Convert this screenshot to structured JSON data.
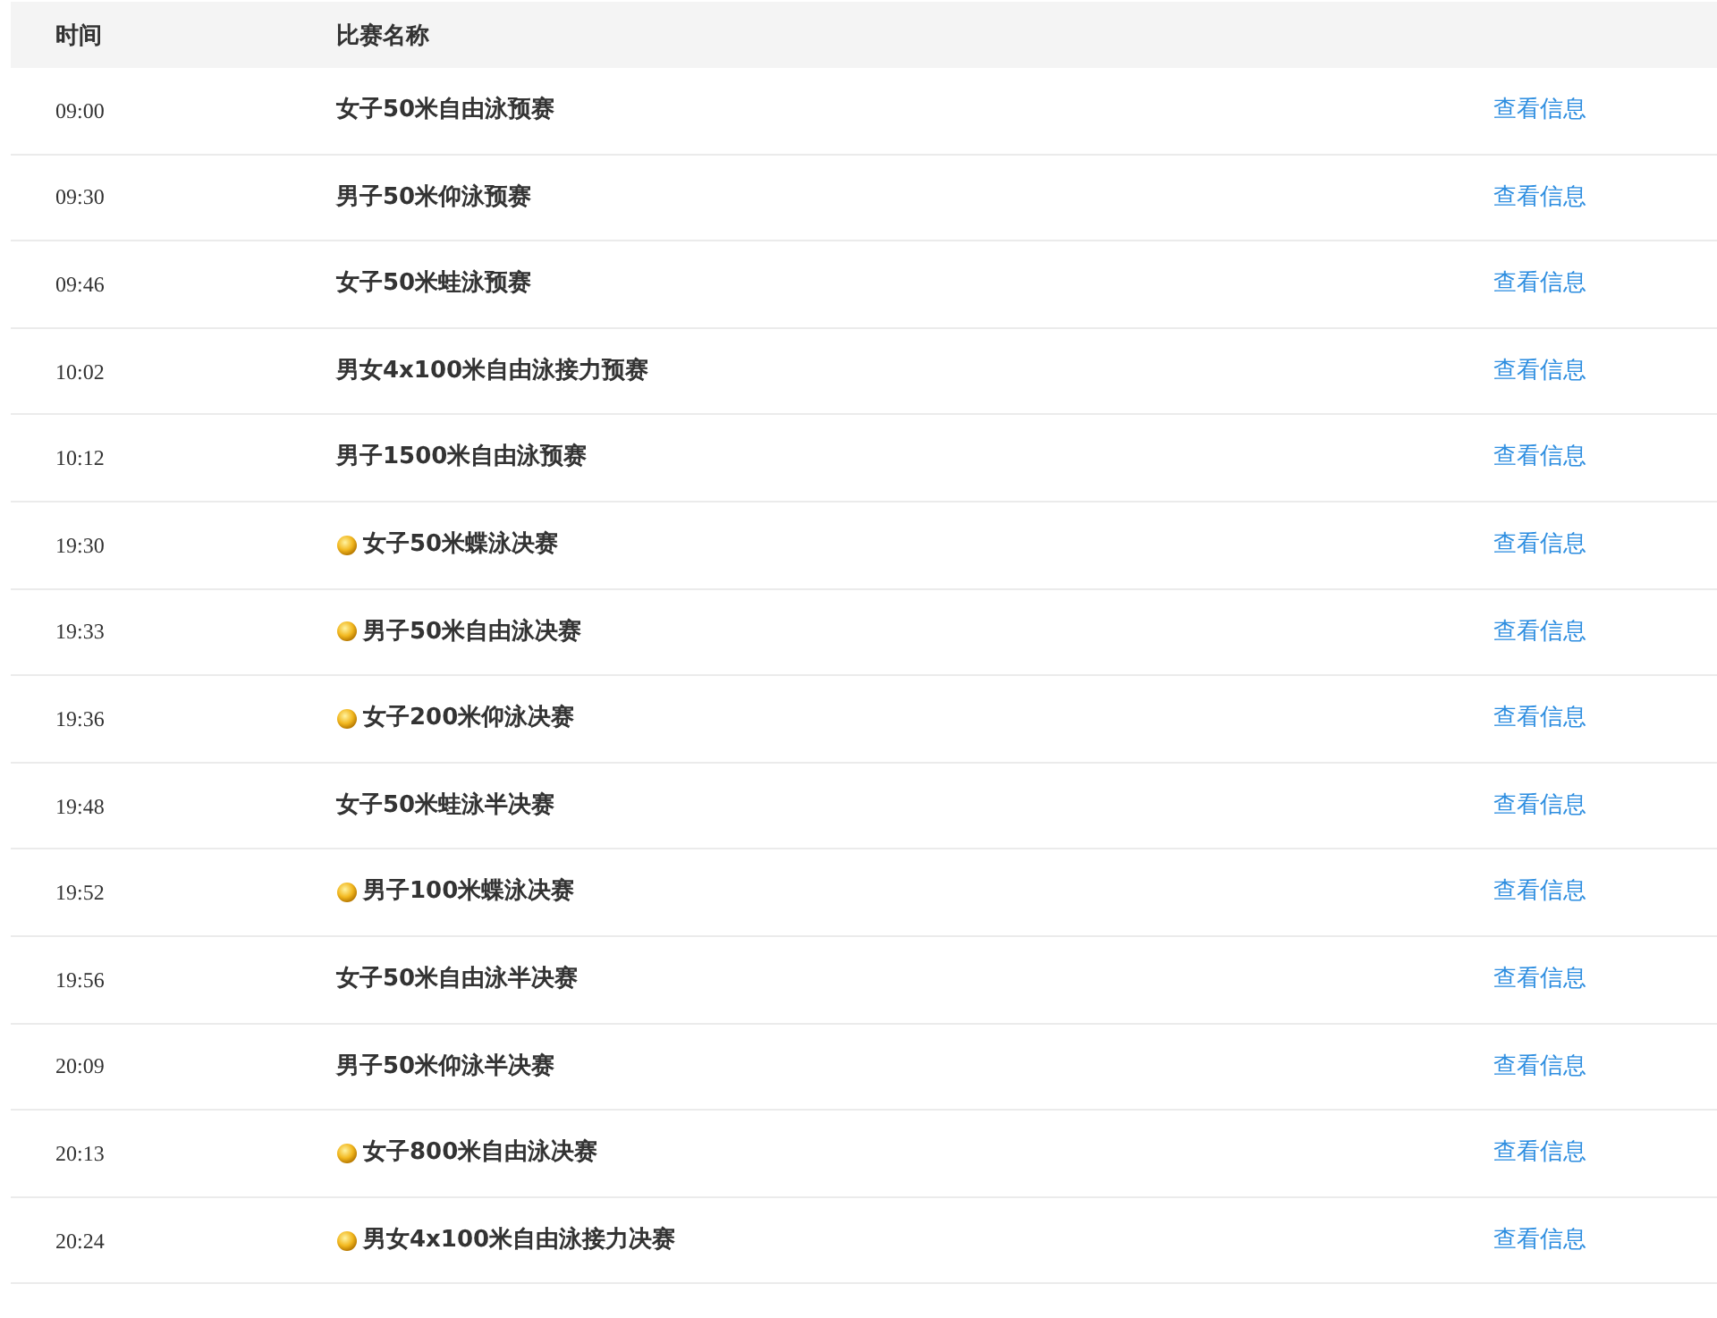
{
  "table": {
    "columns": [
      "时间",
      "比赛名称"
    ],
    "rows": [
      {
        "time": "09:00",
        "event": "女子50米自由泳预赛",
        "medal": false,
        "link": "查看信息"
      },
      {
        "time": "09:30",
        "event": "男子50米仰泳预赛",
        "medal": false,
        "link": "查看信息"
      },
      {
        "time": "09:46",
        "event": "女子50米蛙泳预赛",
        "medal": false,
        "link": "查看信息"
      },
      {
        "time": "10:02",
        "event": "男女4x100米自由泳接力预赛",
        "medal": false,
        "link": "查看信息"
      },
      {
        "time": "10:12",
        "event": "男子1500米自由泳预赛",
        "medal": false,
        "link": "查看信息"
      },
      {
        "time": "19:30",
        "event": "女子50米蝶泳决赛",
        "medal": true,
        "link": "查看信息"
      },
      {
        "time": "19:33",
        "event": "男子50米自由泳决赛",
        "medal": true,
        "link": "查看信息"
      },
      {
        "time": "19:36",
        "event": "女子200米仰泳决赛",
        "medal": true,
        "link": "查看信息"
      },
      {
        "time": "19:48",
        "event": "女子50米蛙泳半决赛",
        "medal": false,
        "link": "查看信息"
      },
      {
        "time": "19:52",
        "event": "男子100米蝶泳决赛",
        "medal": true,
        "link": "查看信息"
      },
      {
        "time": "19:56",
        "event": "女子50米自由泳半决赛",
        "medal": false,
        "link": "查看信息"
      },
      {
        "time": "20:09",
        "event": "男子50米仰泳半决赛",
        "medal": false,
        "link": "查看信息"
      },
      {
        "time": "20:13",
        "event": "女子800米自由泳决赛",
        "medal": true,
        "link": "查看信息"
      },
      {
        "time": "20:24",
        "event": "男女4x100米自由泳接力决赛",
        "medal": true,
        "link": "查看信息"
      }
    ]
  }
}
